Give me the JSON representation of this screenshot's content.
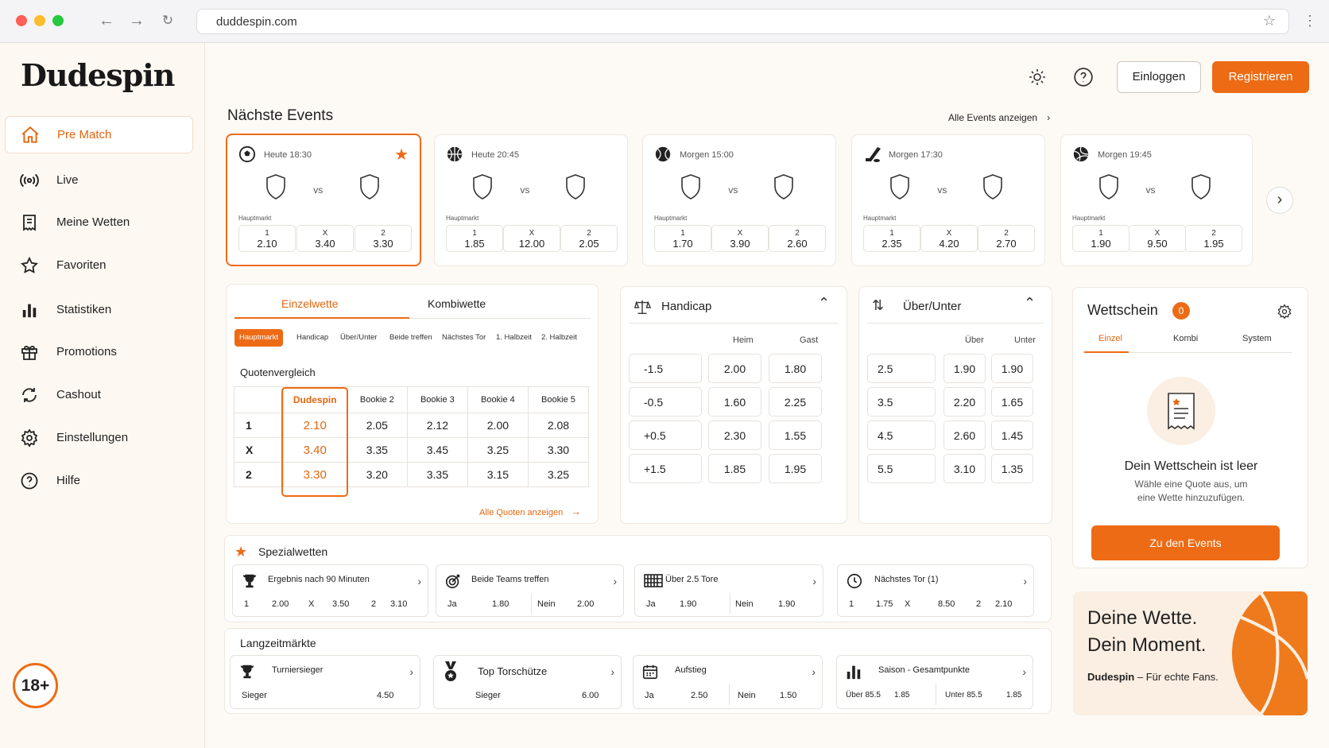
{
  "browser": {
    "url": "duddespin.com"
  },
  "logo": "Dudespin",
  "nav": [
    {
      "label": "Pre Match",
      "icon": "home-icon"
    },
    {
      "label": "Live",
      "icon": "broadcast-icon"
    },
    {
      "label": "Meine Wetten",
      "icon": "receipt-icon"
    },
    {
      "label": "Favoriten",
      "icon": "star-icon"
    },
    {
      "label": "Statistiken",
      "icon": "bar-chart-icon"
    },
    {
      "label": "Promotions",
      "icon": "gift-icon"
    },
    {
      "label": "Cashout",
      "icon": "refresh-icon"
    },
    {
      "label": "Einstellungen",
      "icon": "gear-icon"
    },
    {
      "label": "Hilfe",
      "icon": "help-icon"
    }
  ],
  "age_badge": "18+",
  "header": {
    "login": "Einloggen",
    "register": "Registrieren"
  },
  "events": {
    "title": "Nächste Events",
    "all_link": "Alle Events anzeigen",
    "vs": "vs",
    "market": "Hauptmarkt",
    "items": [
      {
        "time": "Heute 18:30",
        "sport": "football-icon",
        "odds": [
          {
            "l": "1",
            "v": "2.10"
          },
          {
            "l": "X",
            "v": "3.40"
          },
          {
            "l": "2",
            "v": "3.30"
          }
        ]
      },
      {
        "time": "Heute 20:45",
        "sport": "basketball-icon",
        "odds": [
          {
            "l": "1",
            "v": "1.85"
          },
          {
            "l": "X",
            "v": "12.00"
          },
          {
            "l": "2",
            "v": "2.05"
          }
        ]
      },
      {
        "time": "Morgen 15:00",
        "sport": "tennis-icon",
        "odds": [
          {
            "l": "1",
            "v": "1.70"
          },
          {
            "l": "X",
            "v": "3.90"
          },
          {
            "l": "2",
            "v": "2.60"
          }
        ]
      },
      {
        "time": "Morgen 17:30",
        "sport": "hockey-icon",
        "odds": [
          {
            "l": "1",
            "v": "2.35"
          },
          {
            "l": "X",
            "v": "4.20"
          },
          {
            "l": "2",
            "v": "2.70"
          }
        ]
      },
      {
        "time": "Morgen 19:45",
        "sport": "volleyball-icon",
        "odds": [
          {
            "l": "1",
            "v": "1.90"
          },
          {
            "l": "X",
            "v": "9.50"
          },
          {
            "l": "2",
            "v": "1.95"
          }
        ]
      }
    ]
  },
  "bet_tabs": {
    "single": "Einzelwette",
    "combi": "Kombiwette"
  },
  "market_tabs": [
    "Hauptmarkt",
    "Handicap",
    "Über/Unter",
    "Beide treffen",
    "Nächstes Tor",
    "1. Halbzeit",
    "2. Halbzeit"
  ],
  "comparison": {
    "title": "Quotenvergleich",
    "headers": [
      "Dudespin",
      "Bookie 2",
      "Bookie 3",
      "Bookie 4",
      "Bookie 5"
    ],
    "rows": [
      {
        "label": "1",
        "values": [
          "2.10",
          "2.05",
          "2.12",
          "2.00",
          "2.08"
        ]
      },
      {
        "label": "X",
        "values": [
          "3.40",
          "3.35",
          "3.45",
          "3.25",
          "3.30"
        ]
      },
      {
        "label": "2",
        "values": [
          "3.30",
          "3.20",
          "3.35",
          "3.15",
          "3.25"
        ]
      }
    ],
    "all_link": "Alle Quoten anzeigen"
  },
  "handicap": {
    "title": "Handicap",
    "col1": "Heim",
    "col2": "Gast",
    "rows": [
      {
        "h": "-1.5",
        "a": "2.00",
        "b": "1.80"
      },
      {
        "h": "-0.5",
        "a": "1.60",
        "b": "2.25"
      },
      {
        "h": "+0.5",
        "a": "2.30",
        "b": "1.55"
      },
      {
        "h": "+1.5",
        "a": "1.85",
        "b": "1.95"
      }
    ]
  },
  "overunder": {
    "title": "Über/Unter",
    "col1": "Über",
    "col2": "Unter",
    "rows": [
      {
        "h": "2.5",
        "a": "1.90",
        "b": "1.90"
      },
      {
        "h": "3.5",
        "a": "2.20",
        "b": "1.65"
      },
      {
        "h": "4.5",
        "a": "2.60",
        "b": "1.45"
      },
      {
        "h": "5.5",
        "a": "3.10",
        "b": "1.35"
      }
    ]
  },
  "betslip": {
    "title": "Wettschein",
    "count": "0",
    "tabs": [
      "Einzel",
      "Kombi",
      "System"
    ],
    "empty_title": "Dein Wettschein ist leer",
    "empty_text1": "Wähle eine Quote aus, um",
    "empty_text2": "eine Wette hinzuzufügen.",
    "cta": "Zu den Events"
  },
  "promo": {
    "line1": "Deine Wette.",
    "line2": "Dein Moment.",
    "brand": "Dudespin",
    "tagline": " – Für echte Fans."
  },
  "special": {
    "title": "Spezialwetten",
    "cards": [
      {
        "title": "Ergebnis nach 90 Minuten",
        "icon": "trophy-icon",
        "o": [
          "1",
          "2.00",
          "X",
          "3.50",
          "2",
          "3.10"
        ]
      },
      {
        "title": "Beide Teams treffen",
        "icon": "target-icon",
        "o": [
          "Ja",
          "1.80",
          "Nein",
          "2.00"
        ]
      },
      {
        "title": "Über 2.5 Tore",
        "icon": "goal-net-icon",
        "o": [
          "Ja",
          "1.90",
          "Nein",
          "1.90"
        ]
      },
      {
        "title": "Nächstes Tor (1)",
        "icon": "clock-icon",
        "o": [
          "1",
          "1.75",
          "X",
          "8.50",
          "2",
          "2.10"
        ]
      }
    ]
  },
  "longterm": {
    "title": "Langzeitmärkte",
    "cards": [
      {
        "title": "Turniersieger",
        "icon": "trophy-icon",
        "o": [
          "Sieger",
          "4.50"
        ]
      },
      {
        "title": "Top Torschütze",
        "icon": "medal-icon",
        "o": [
          "Sieger",
          "6.00"
        ]
      },
      {
        "title": "Aufstieg",
        "icon": "calendar-icon",
        "o": [
          "Ja",
          "2.50",
          "Nein",
          "1.50"
        ]
      },
      {
        "title": "Saison - Gesamtpunkte",
        "icon": "bar-chart-icon",
        "o": [
          "Über 85.5",
          "1.85",
          "Unter 85.5",
          "1.85"
        ]
      }
    ]
  },
  "colors": {
    "accent": "#ed6b15",
    "sidebar_bg": "#fdf8f2"
  }
}
